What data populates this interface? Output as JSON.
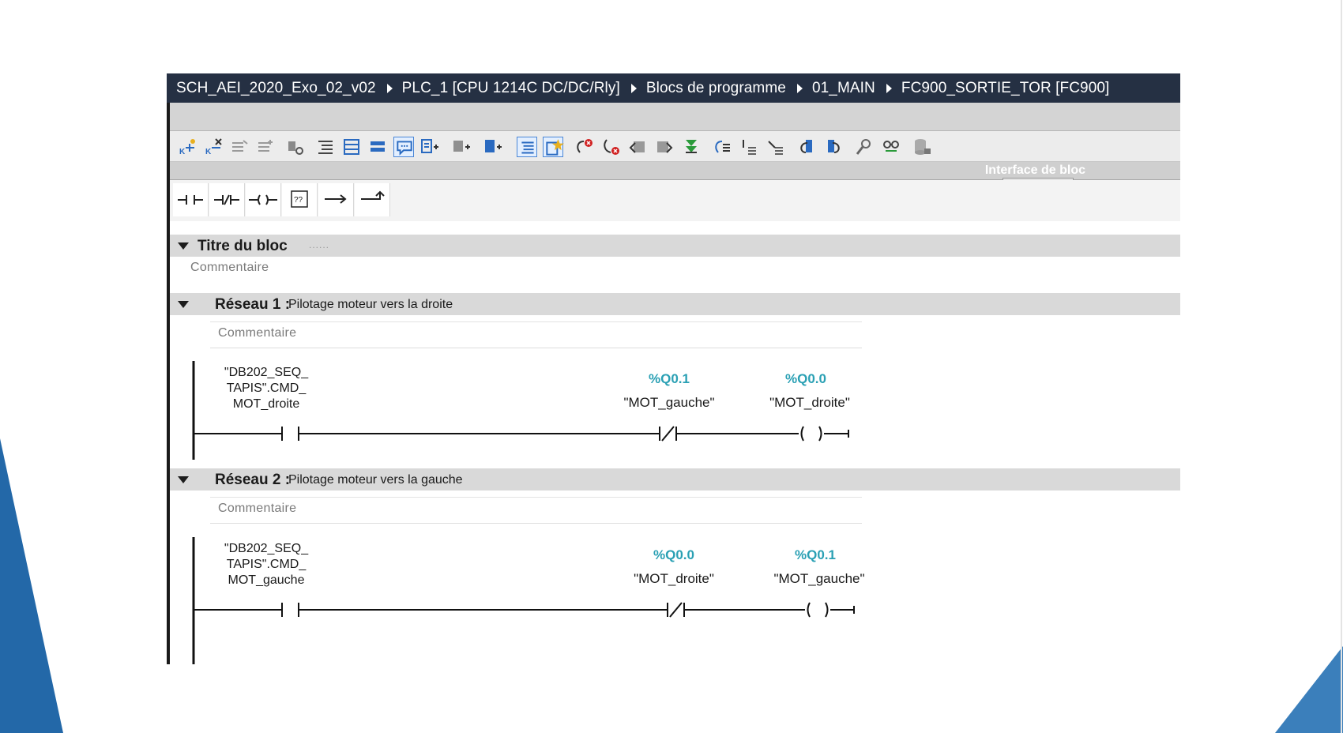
{
  "breadcrumb": [
    "SCH_AEI_2020_Exo_02_v02",
    "PLC_1 [CPU 1214C DC/DC/Rly]",
    "Blocs de programme",
    "01_MAIN",
    "FC900_SORTIE_TOR [FC900]"
  ],
  "toolbar": {
    "icons": [
      "insert-network-icon",
      "delete-network-icon",
      "insert-row-icon",
      "add-row-icon",
      "monitor-icon",
      "network-list-icon",
      "absolute-operands-icon",
      "favorites-bar-icon",
      "comments-icon",
      "expand-networks-icon",
      "collapse-networks-icon",
      "open-all-icon",
      "operand-display-icon",
      "show-favorites-icon",
      "go-to-error-icon",
      "clear-error-icon",
      "previous-error-icon",
      "next-error-icon",
      "compile-icon",
      "call-hierarchy-icon",
      "expand-icon",
      "collapse-icon",
      "back-icon",
      "forward-icon",
      "monitor-on-icon",
      "glasses-icon",
      "database-lock-icon"
    ]
  },
  "interface": {
    "label": "Interface de bloc"
  },
  "ladder_palette": {
    "items": [
      "no-contact-icon",
      "nc-contact-icon",
      "coil-icon",
      "empty-box-icon",
      "open-branch-icon",
      "close-branch-icon"
    ]
  },
  "block": {
    "title": "Titre du bloc",
    "title_dots": "......",
    "comment": "Commentaire"
  },
  "networks": [
    {
      "label": "Réseau 1 :",
      "title": "Pilotage moteur vers la droite",
      "comment": "Commentaire",
      "contact_var": "\"DB202_SEQ_\nTAPIS\".CMD_\nMOT_droite",
      "nc_address": "%Q0.1",
      "nc_tag": "\"MOT_gauche\"",
      "coil_address": "%Q0.0",
      "coil_tag": "\"MOT_droite\""
    },
    {
      "label": "Réseau 2 :",
      "title": "Pilotage moteur vers la gauche",
      "comment": "Commentaire",
      "contact_var": "\"DB202_SEQ_\nTAPIS\".CMD_\nMOT_gauche",
      "nc_address": "%Q0.0",
      "nc_tag": "\"MOT_droite\"",
      "coil_address": "%Q0.1",
      "coil_tag": "\"MOT_gauche\""
    }
  ],
  "colors": {
    "title_bar": "#253043",
    "address": "#2aa0b4",
    "slide_accent": "#2368a8"
  }
}
